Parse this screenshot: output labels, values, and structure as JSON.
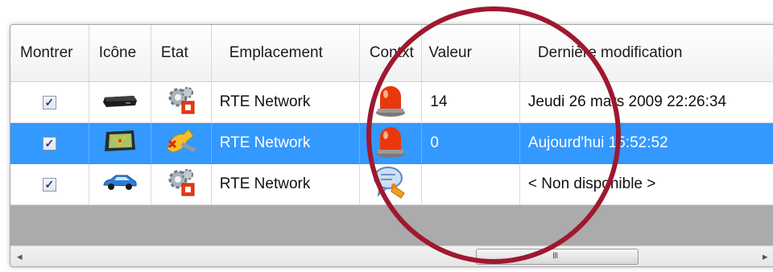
{
  "table": {
    "headers": [
      "Montrer",
      "Icône",
      "Etat",
      "Emplacement",
      "Contxt",
      "Valeur",
      "Dernière modification"
    ],
    "rows": [
      {
        "show_checked": true,
        "device_icon": "black-device-icon",
        "state_icon": "gears-red-icon",
        "location": "RTE Network",
        "context_icon": "red-alarm-light-icon",
        "value": "14",
        "modified": "Jeudi 26 mars 2009 22:26:34",
        "selected": false
      },
      {
        "show_checked": true,
        "device_icon": "gps-screen-icon",
        "state_icon": "broken-connection-icon",
        "location": "RTE Network",
        "context_icon": "red-alarm-light-icon",
        "value": "0",
        "modified": "Aujourd'hui 15:52:52",
        "selected": true
      },
      {
        "show_checked": true,
        "device_icon": "blue-car-icon",
        "state_icon": "gears-red-icon",
        "location": "RTE Network",
        "context_icon": "chat-hand-icon",
        "value": "",
        "modified": "< Non disponible >",
        "selected": false
      }
    ]
  },
  "colors": {
    "selection": "#3399ff",
    "highlight_ring": "#9e1830"
  },
  "scrollbar": {
    "left_arrow": "◂",
    "right_arrow": "▸",
    "grip": "III"
  }
}
